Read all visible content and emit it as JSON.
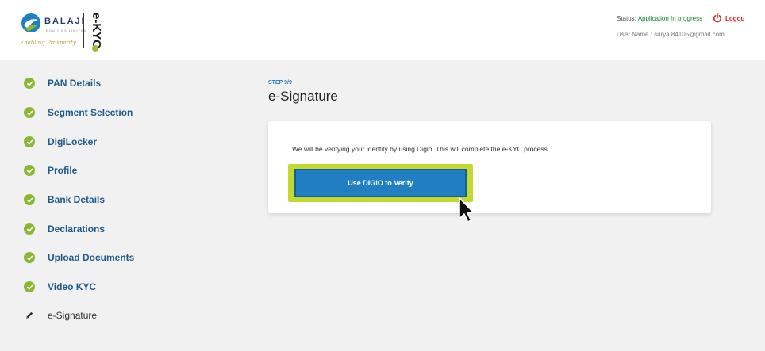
{
  "header": {
    "brand_name": "BALAJI",
    "brand_sub": "EQUITIES LIMITED",
    "tagline": "Enabling Prosperity",
    "kyc_mark": "e-KYC",
    "status_label": "Status:",
    "status_value": "Application In progress",
    "logout_label": "Logou",
    "user_line": "User Name : surya.84105@gmail.com",
    "colors": {
      "status": "#1a8a2e",
      "logout": "#d9231f",
      "brand": "#2b3a6e"
    },
    "logout_icon": "power-icon"
  },
  "steps": [
    {
      "label": "PAN Details",
      "state": "done"
    },
    {
      "label": "Segment Selection",
      "state": "done"
    },
    {
      "label": "DigiLocker",
      "state": "done"
    },
    {
      "label": "Profile",
      "state": "done"
    },
    {
      "label": "Bank Details",
      "state": "done"
    },
    {
      "label": "Declarations",
      "state": "done"
    },
    {
      "label": "Upload Documents",
      "state": "done"
    },
    {
      "label": "Video KYC",
      "state": "done"
    },
    {
      "label": "e-Signature",
      "state": "current"
    }
  ],
  "main": {
    "step_tag": "STEP 9/9",
    "title": "e-Signature",
    "message": "We will be verifying your identity by using Digio. This will complete the e-KYC process.",
    "verify_button": "Use DIGIO to Verify",
    "colors": {
      "accent": "#1f7fc2",
      "highlight": "#c4d92e",
      "done": "#8ab833"
    }
  }
}
